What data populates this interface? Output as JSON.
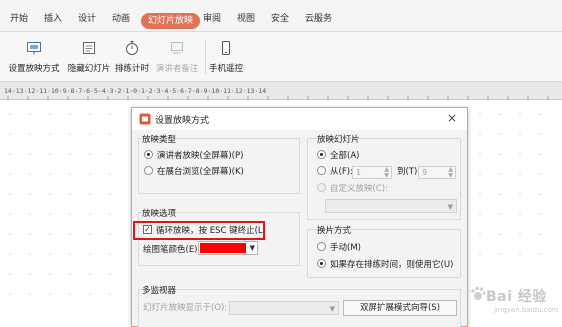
{
  "tabs": [
    {
      "label": "开始",
      "active": false
    },
    {
      "label": "插入",
      "active": false
    },
    {
      "label": "设计",
      "active": false
    },
    {
      "label": "动画",
      "active": false
    },
    {
      "label": "幻灯片放映",
      "active": true
    },
    {
      "label": "审阅",
      "active": false
    },
    {
      "label": "视图",
      "active": false
    },
    {
      "label": "安全",
      "active": false
    },
    {
      "label": "云服务",
      "active": false
    }
  ],
  "ribbon": {
    "setup_show": "设置放映方式",
    "hide_slide": "隐藏幻灯片",
    "rehearse": "排练计时",
    "speaker_notes": "演讲者备注",
    "phone_remote": "手机遥控"
  },
  "ruler_text": "14·13·12·11·10·9·8·7·6·5·4·3·2·1·0·1·2·3·4·5·6·7·8·9·10·11·12·13·14",
  "dialog": {
    "title": "设置放映方式",
    "close": "×",
    "show_type": {
      "title": "放映类型",
      "options": [
        {
          "label": "演讲者放映(全屏幕)(P)",
          "checked": true
        },
        {
          "label": "在展台浏览(全屏幕)(K)",
          "checked": false
        }
      ]
    },
    "show_slides": {
      "title": "放映幻灯片",
      "all": "全部(A)",
      "from": "从(F):",
      "from_value": "1",
      "to": "到(T):",
      "to_value": "9",
      "custom": "自定义放映(C):"
    },
    "show_options": {
      "title": "放映选项",
      "loop": "循环放映，按 ESC 键终止(L)",
      "loop_checked": true,
      "pen_color": "绘图笔颜色(E):",
      "pen_color_value": "#ff0000"
    },
    "advance": {
      "title": "换片方式",
      "manual": "手动(M)",
      "timing": "如果存在排练时间，则使用它(U)",
      "timing_checked": true
    },
    "multi_monitor": {
      "title": "多监视器",
      "display_on": "幻灯片放映显示于(O):",
      "wizard_button": "双屏扩展模式向导(S)"
    }
  },
  "watermark": {
    "text": "Bai 经验",
    "sub": "jingyan.baidu.com"
  },
  "colors": {
    "active_tab": "#e07256",
    "highlight": "#e0141e",
    "dialog_border": "#e89a7d"
  }
}
